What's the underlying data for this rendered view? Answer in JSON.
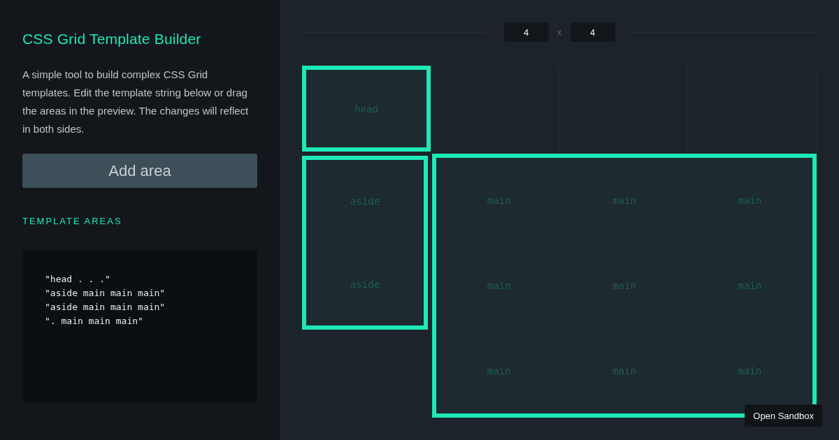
{
  "sidebar": {
    "title": "CSS Grid Template Builder",
    "description": "A simple tool to build complex CSS Grid templates. Edit the template string below or drag the areas in the preview. The changes will reflect in both sides.",
    "add_button": "Add area",
    "section_heading": "TEMPLATE AREAS",
    "template_lines": [
      "\"head . . .\"",
      "\"aside main main main\"",
      "\"aside main main main\"",
      "\". main main main\""
    ]
  },
  "preview": {
    "columns": "4",
    "separator": "x",
    "rows": "4",
    "areas": [
      {
        "cells": [
          [
            "head"
          ]
        ]
      },
      {
        "cells": [
          [
            "aside"
          ],
          [
            "aside"
          ]
        ]
      },
      {
        "cells": [
          [
            "main",
            "main",
            "main"
          ],
          [
            "main",
            "main",
            "main"
          ],
          [
            "main",
            "main",
            "main"
          ]
        ]
      }
    ]
  },
  "sandbox_button": "Open Sandbox"
}
